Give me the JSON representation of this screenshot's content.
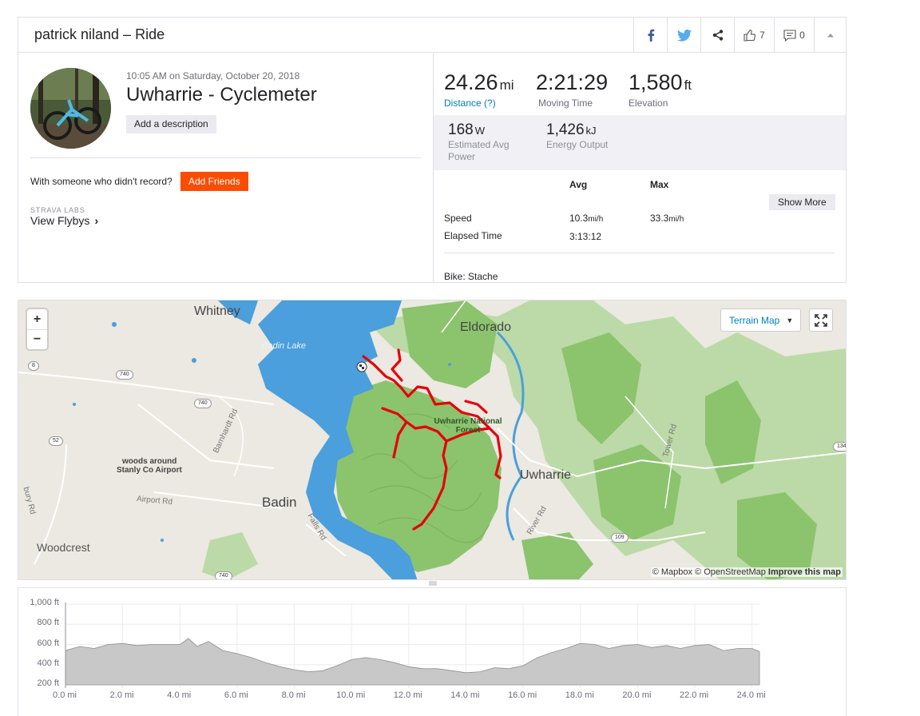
{
  "header": {
    "title": "patrick niland – Ride",
    "kudos_count": "7",
    "comments_count": "0"
  },
  "activity": {
    "datetime": "10:05 AM on Saturday, October 20, 2018",
    "name": "Uwharrie - Cyclemeter",
    "add_description_label": "Add a description",
    "with_someone_text": "With someone who didn't record?",
    "add_friends_label": "Add Friends",
    "labs_label": "STRAVA LABS",
    "flybys_label": "View Flybys"
  },
  "stats": {
    "distance": {
      "value": "24.26",
      "unit": "mi",
      "label": "Distance (?)"
    },
    "moving_time": {
      "value": "2:21:29",
      "label": "Moving Time"
    },
    "elevation": {
      "value": "1,580",
      "unit": "ft",
      "label": "Elevation"
    },
    "power": {
      "value": "168",
      "unit": "W",
      "label": "Estimated Avg Power"
    },
    "energy": {
      "value": "1,426",
      "unit": "kJ",
      "label": "Energy Output"
    }
  },
  "more_stats": {
    "col_avg": "Avg",
    "col_max": "Max",
    "show_more_label": "Show More",
    "speed_label": "Speed",
    "speed_avg": "10.3",
    "speed_avg_unit": "mi/h",
    "speed_max": "33.3",
    "speed_max_unit": "mi/h",
    "elapsed_label": "Elapsed Time",
    "elapsed_avg": "3:13:12",
    "bike": "Bike: Stache"
  },
  "map": {
    "terrain_label": "Terrain Map",
    "zoom_in": "+",
    "zoom_out": "−",
    "attribution_1": "© Mapbox © OpenStreetMap ",
    "attribution_2": "Improve this map",
    "labels": {
      "whitney": "Whitney",
      "eldorado": "Eldorado",
      "badin_lake": "Badin Lake",
      "uwharrie_nf_1": "Uwharrie National",
      "uwharrie_nf_2": "Forest",
      "uwharrie": "Uwharrie",
      "badin": "Badin",
      "woods_1": "woods around",
      "woods_2": "Stanly Co Airport",
      "woodcrest": "Woodcrest",
      "barnhardt": "Barnhardt Rd",
      "airport_rd": "Airport Rd",
      "falls_rd": "Falls Rd",
      "river_rd": "River Rd",
      "tower_rd": "Tower Rd",
      "bury_rd": "bury Rd",
      "s740a": "740",
      "s740b": "740",
      "s740c": "740",
      "s8": "8",
      "s52": "52",
      "s109": "109",
      "s134": "134"
    },
    "colors": {
      "route": "#e5000b",
      "water": "#4a9fdc",
      "forest": "#8fc872",
      "land": "#ebe9e1"
    }
  },
  "chart_data": {
    "type": "area",
    "y_ticks": [
      "1,000 ft",
      "800 ft",
      "600 ft",
      "400 ft",
      "200 ft"
    ],
    "x_ticks": [
      "0.0 mi",
      "2.0 mi",
      "4.0 mi",
      "6.0 mi",
      "8.0 mi",
      "10.0 mi",
      "12.0 mi",
      "14.0 mi",
      "16.0 mi",
      "18.0 mi",
      "20.0 mi",
      "22.0 mi",
      "24.0 mi"
    ],
    "xlim": [
      0,
      24.26
    ],
    "ylim": [
      200,
      1000
    ],
    "x": [
      0,
      0.5,
      1,
      1.5,
      2,
      2.5,
      3,
      3.5,
      4,
      4.3,
      4.6,
      5,
      5.5,
      6,
      6.5,
      7,
      7.5,
      8,
      8.5,
      9,
      9.5,
      10,
      10.5,
      11,
      11.5,
      12,
      12.5,
      13,
      13.5,
      14,
      14.5,
      15,
      15.5,
      16,
      16.5,
      17,
      17.5,
      18,
      18.5,
      19,
      19.5,
      20,
      20.5,
      21,
      21.5,
      22,
      22.5,
      23,
      23.5,
      24,
      24.26
    ],
    "elevation": [
      540,
      580,
      560,
      600,
      610,
      590,
      600,
      600,
      600,
      660,
      580,
      630,
      540,
      510,
      470,
      420,
      380,
      350,
      330,
      340,
      390,
      450,
      470,
      450,
      420,
      380,
      360,
      360,
      340,
      320,
      330,
      370,
      360,
      390,
      470,
      520,
      560,
      610,
      600,
      560,
      590,
      600,
      570,
      590,
      560,
      590,
      600,
      540,
      560,
      560,
      530
    ],
    "fill_color": "#c8c8c8",
    "line_color": "#8f8f8f"
  }
}
